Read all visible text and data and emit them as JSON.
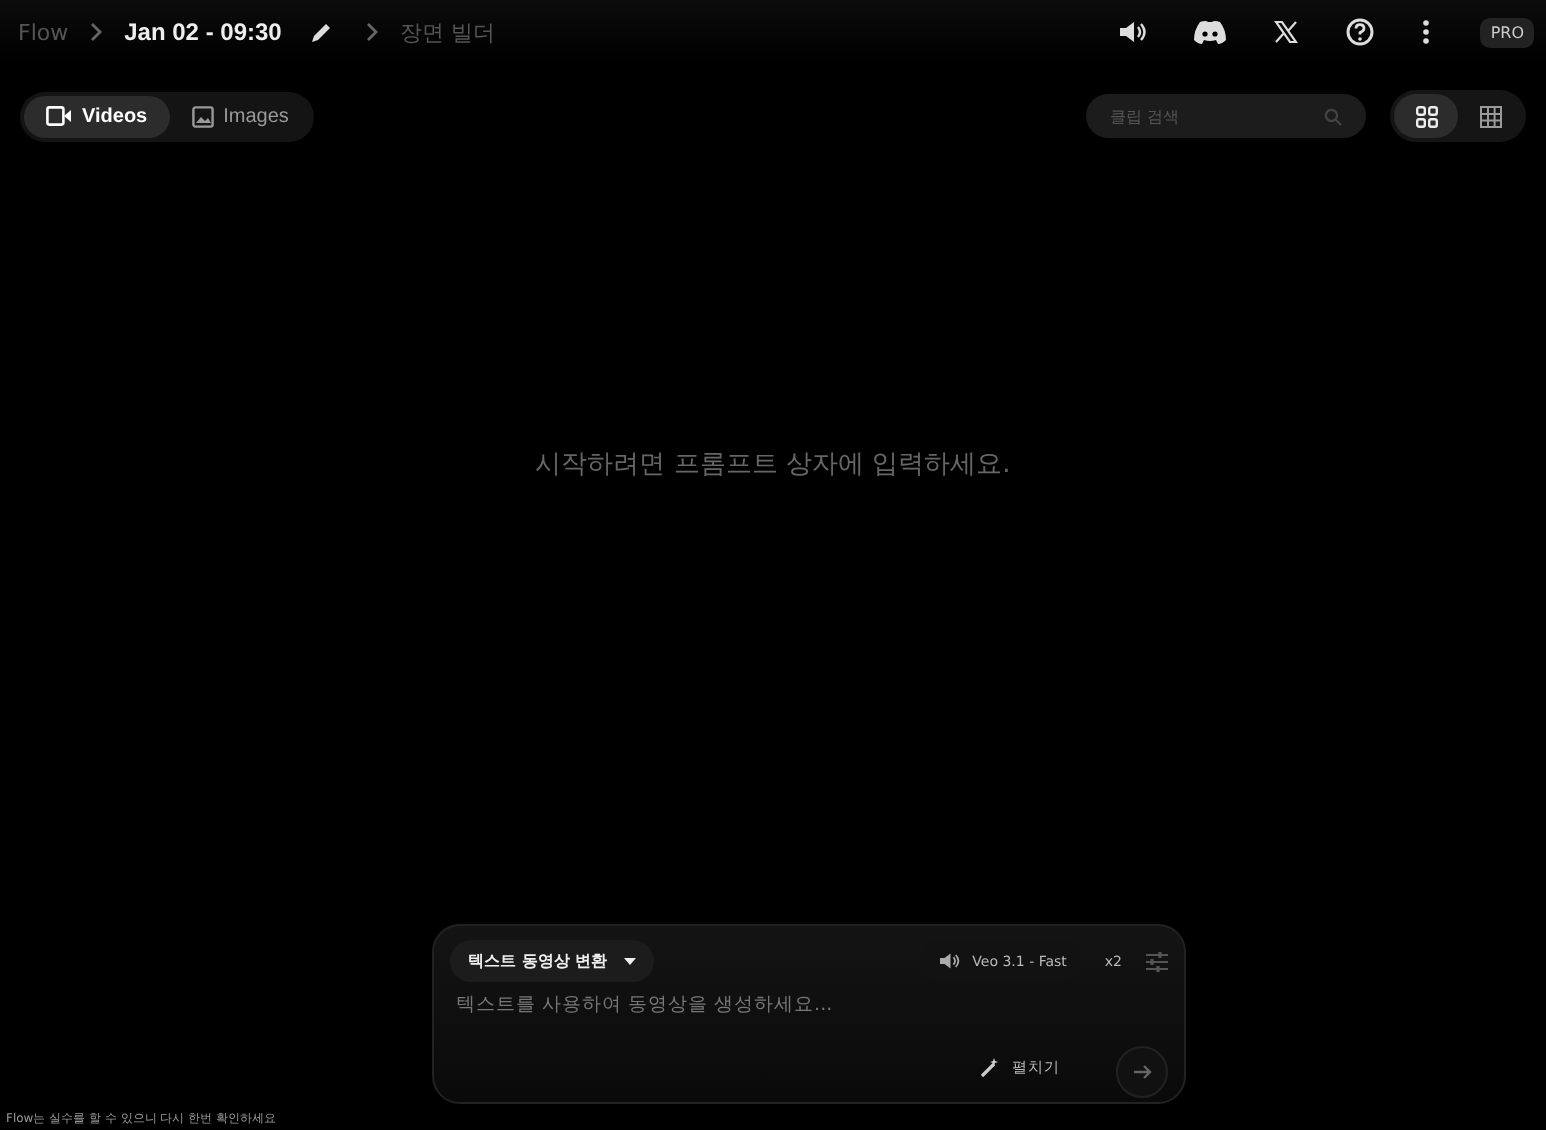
{
  "breadcrumb": [
    {
      "label": "Flow",
      "kind": "root"
    },
    {
      "label": "Jan 02 - 09:30",
      "kind": "current"
    },
    {
      "label": "장면 빌더",
      "kind": "link"
    }
  ],
  "header_pro": "PRO",
  "media_tabs": [
    {
      "label": "Videos",
      "selected": true,
      "kind": "video"
    },
    {
      "label": "Images",
      "selected": false,
      "kind": "image"
    }
  ],
  "search": {
    "placeholder": "클립 검색"
  },
  "view_toggles": [
    {
      "kind": "grid",
      "selected": true
    },
    {
      "kind": "dense",
      "selected": false
    }
  ],
  "empty_message": "시작하려면 프롬프트 상자에 입력하세요.",
  "composer": {
    "mode": "텍스트 동영상 변환",
    "model": "Veo 3.1 - Fast",
    "count": "x2",
    "placeholder": "텍스트를 사용하여 동영상을 생성하세요...",
    "expand": "펼치기"
  },
  "disclaimer": "Flow는 실수를 할 수 있으니 다시 한번 확인하세요"
}
